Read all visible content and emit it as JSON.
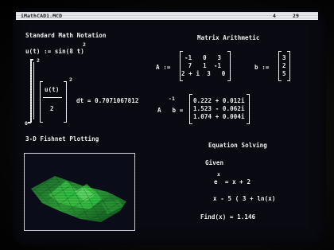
{
  "window": {
    "title": "iMathCAD1.MCD",
    "page_number": "4",
    "column_number": "29"
  },
  "math_notation": {
    "heading": "Standard Math Notation",
    "definition": "u(t) := sin(8 t)",
    "exponent": "2",
    "integral_upper": "2",
    "integral_lower": "0",
    "integrand_numerator": "u(t)",
    "integrand_denominator": "2",
    "integral_exponent": "2",
    "integral_result": "dt = 0.7071067812"
  },
  "matrix": {
    "heading": "Matrix Arithmetic",
    "a_label": "A :=",
    "a_rows": [
      "-1   0   3",
      " 7   1  -1",
      "2 + i  3   0"
    ],
    "b_label": "b :=",
    "b_values": [
      "3",
      "2",
      "5"
    ],
    "inv_exponent": "-1",
    "product_label": "A   b =",
    "result_rows": [
      "0.222 + 0.012i",
      "1.523 - 0.062i",
      "1.074 + 0.004i"
    ]
  },
  "fishnet": {
    "heading": "3-D Fishnet Plotting"
  },
  "equation": {
    "heading": "Equation Solving",
    "given": "Given",
    "exp_superscript": "x",
    "eq1": "e  = x + 2",
    "eq2": "x - 5 ( 3 + ln(x)",
    "find": "Find(x) = 1.146"
  }
}
